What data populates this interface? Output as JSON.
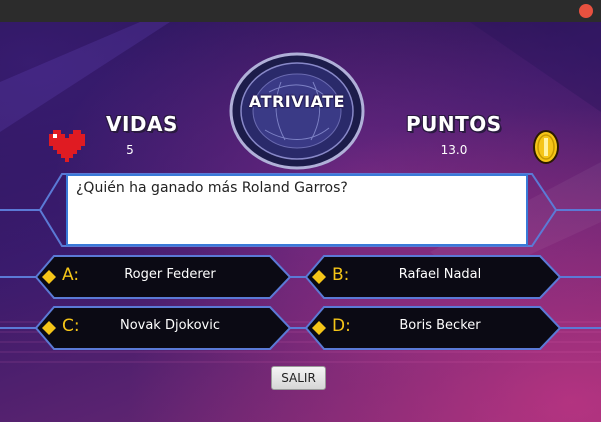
{
  "game": {
    "logo_text": "ATRIVIATE",
    "lives": {
      "label": "VIDAS",
      "value": "5"
    },
    "points": {
      "label": "PUNTOS",
      "value": "13.0"
    },
    "question": "¿Quién ha ganado más Roland Garros?",
    "answers": [
      {
        "letter": "A:",
        "text": "Roger Federer"
      },
      {
        "letter": "B:",
        "text": "Rafael Nadal"
      },
      {
        "letter": "C:",
        "text": "Novak Djokovic"
      },
      {
        "letter": "D:",
        "text": "Boris Becker"
      }
    ],
    "exit_label": "SALIR"
  },
  "colors": {
    "accent_gold": "#f5c518",
    "frame_blue": "#5b7ad6",
    "heart_red": "#e01b22"
  }
}
